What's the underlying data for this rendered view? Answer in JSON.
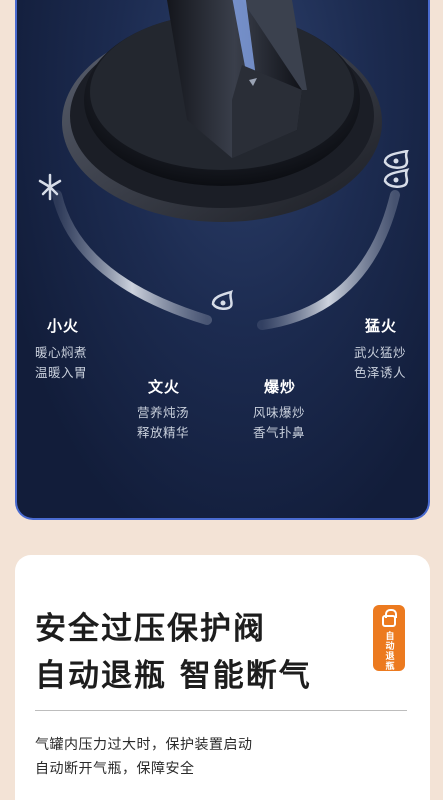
{
  "modes": {
    "small": {
      "title": "小火",
      "desc1": "暖心焖煮",
      "desc2": "温暖入胃"
    },
    "gentle": {
      "title": "文火",
      "desc1": "营养炖汤",
      "desc2": "释放精华"
    },
    "stir": {
      "title": "爆炒",
      "desc1": "风味爆炒",
      "desc2": "香气扑鼻"
    },
    "fierce": {
      "title": "猛火",
      "desc1": "武火猛炒",
      "desc2": "色泽诱人"
    }
  },
  "feature": {
    "headline1": "安全过压保护阀",
    "headline2": "自动退瓶 智能断气",
    "body1": "气罐内压力过大时，保护装置启动",
    "body2": "自动断开气瓶，保障安全",
    "badge_label": "自动退瓶"
  },
  "colors": {
    "panel_bg": "#1c2b50",
    "panel_border": "#4a6bd0",
    "page_bg": "#f3e3d6",
    "badge": "#ec7a1f"
  },
  "icons": [
    "off-icon",
    "flame-small-icon",
    "flame-large-icon"
  ]
}
